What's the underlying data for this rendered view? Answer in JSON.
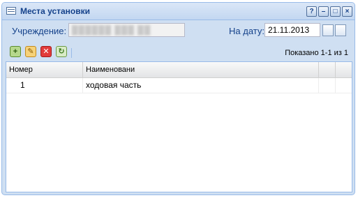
{
  "window": {
    "title": "Места установки",
    "buttons": [
      "?",
      "–",
      "□",
      "×"
    ]
  },
  "filter": {
    "institution_label": "Учреждение:",
    "institution_value": "██████ ███ ██",
    "date_label": "На дату:",
    "date_value": "21.11.2013"
  },
  "toolbar": {
    "add_icon": "+",
    "edit_icon": "✎",
    "delete_icon": "✕",
    "refresh_icon": "↻",
    "paging_text": "Показано 1-1 из 1"
  },
  "grid": {
    "columns": [
      "Номер",
      "Наименовани"
    ],
    "rows": [
      {
        "number": "1",
        "name": "ходовая часть"
      }
    ]
  },
  "colors": {
    "accent": "#15428b",
    "panel": "#cfdff2",
    "border": "#99bbe8"
  }
}
